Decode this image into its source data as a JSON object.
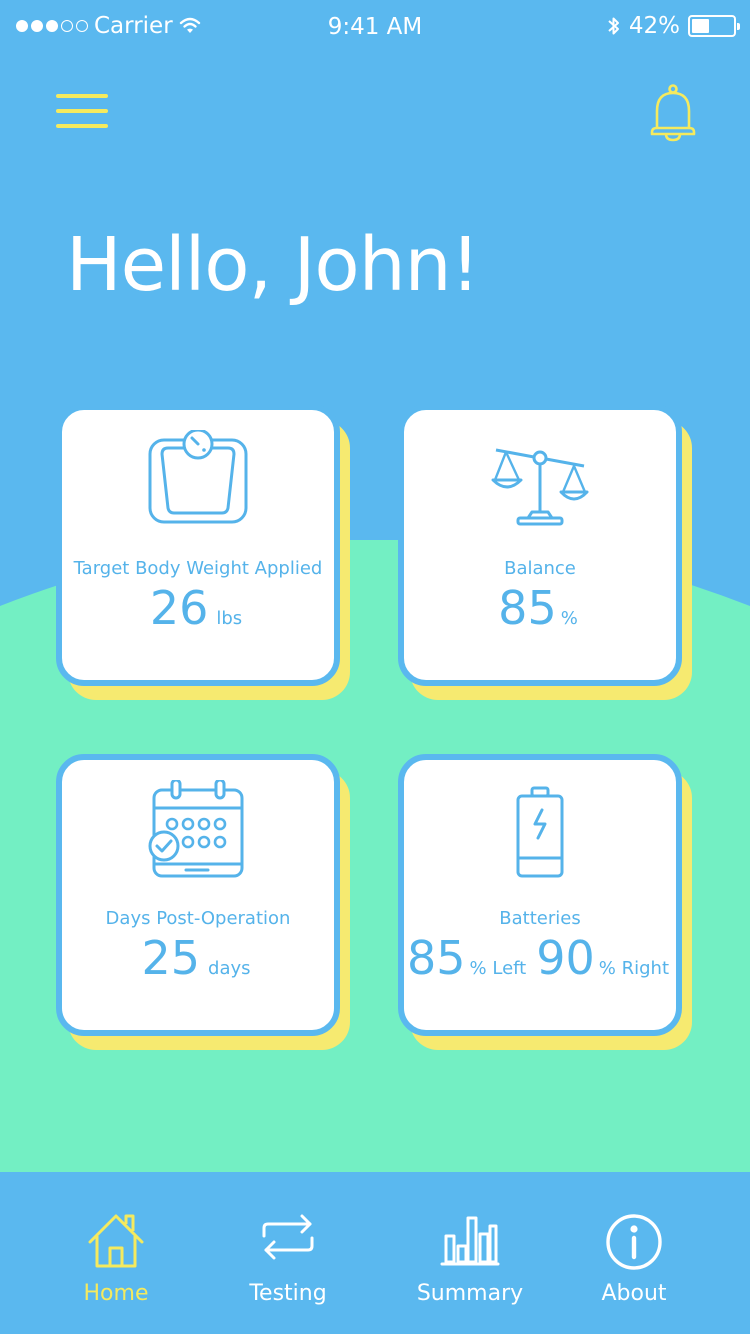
{
  "status_bar": {
    "carrier": "Carrier",
    "time": "9:41 AM",
    "battery_pct": "42%",
    "battery_level": 0.42,
    "signal_bars": 3,
    "signal_total": 5
  },
  "header": {
    "menu_icon": "hamburger-menu-icon",
    "notification_icon": "bell-icon"
  },
  "greeting": "Hello, John!",
  "colors": {
    "background": "#5ab8ef",
    "wave": "#73efc3",
    "card": "#ffffff",
    "card_shadow": "#f6ea70",
    "accent_blue": "#55b3ea",
    "accent_yellow": "#f5ea5e"
  },
  "cards": {
    "weight": {
      "icon": "scale-icon",
      "label": "Target Body Weight Applied",
      "value": "26",
      "unit": "lbs"
    },
    "balance": {
      "icon": "balance-scale-icon",
      "label": "Balance",
      "value": "85",
      "unit": "%"
    },
    "days": {
      "icon": "calendar-icon",
      "label": "Days Post-Operation",
      "value": "25",
      "unit": "days"
    },
    "batteries": {
      "icon": "battery-icon",
      "label": "Batteries",
      "left_value": "85",
      "left_unit": "% Left",
      "right_value": "90",
      "right_unit": "% Right"
    }
  },
  "nav": {
    "active": "Home",
    "items": [
      {
        "label": "Home",
        "icon": "home-icon"
      },
      {
        "label": "Testing",
        "icon": "swap-arrows-icon"
      },
      {
        "label": "Summary",
        "icon": "bar-chart-icon"
      },
      {
        "label": "About",
        "icon": "info-icon"
      }
    ]
  }
}
